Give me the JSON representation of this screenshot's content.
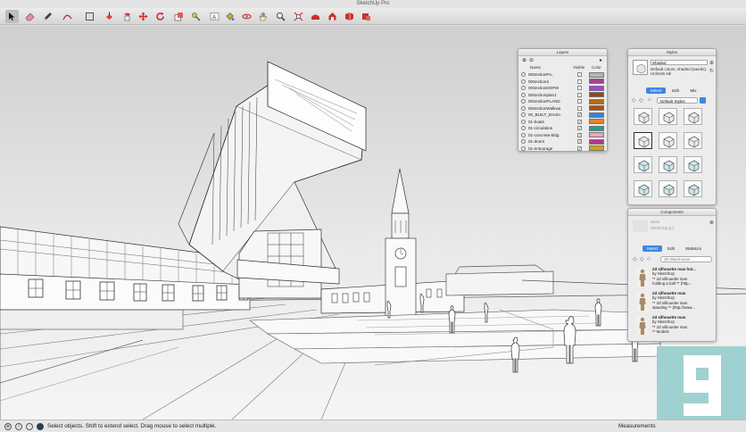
{
  "app": {
    "title": "SketchUp Pro"
  },
  "toolbar": {
    "tools": [
      {
        "icon": "select-arrow-icon",
        "active": true
      },
      {
        "icon": "eraser-icon"
      },
      {
        "icon": "line-pencil-icon"
      },
      {
        "icon": "arc-icon"
      },
      {
        "icon": "rectangle-icon"
      },
      {
        "icon": "push-pull-icon"
      },
      {
        "icon": "move-icon"
      },
      {
        "icon": "rotate-icon"
      },
      {
        "icon": "scale-icon"
      },
      {
        "icon": "offset-icon"
      },
      {
        "icon": "tape-measure-icon"
      },
      {
        "icon": "text-icon"
      },
      {
        "icon": "paint-bucket-icon"
      },
      {
        "icon": "orbit-icon"
      },
      {
        "icon": "pan-icon"
      },
      {
        "icon": "zoom-icon"
      },
      {
        "icon": "zoom-extents-icon"
      },
      {
        "icon": "warehouse-icon"
      },
      {
        "icon": "extension-warehouse-icon"
      },
      {
        "icon": "layout-icon"
      }
    ]
  },
  "layers_panel": {
    "title": "Layers",
    "columns": {
      "name": "Name",
      "visible": "Visible",
      "color": "Color"
    },
    "rows": [
      {
        "name": "00SectionPs..",
        "visible": false,
        "color": "#b5b5b5"
      },
      {
        "name": "00Section4",
        "visible": false,
        "color": "#a4438f"
      },
      {
        "name": "00SectionDOFM",
        "visible": false,
        "color": "#a83ee0"
      },
      {
        "name": "00Sectionplan1",
        "visible": false,
        "color": "#8b4a1e"
      },
      {
        "name": "00SectionPLAND",
        "visible": false,
        "color": "#b76a18"
      },
      {
        "name": "00SectionWalkwa",
        "visible": false,
        "color": "#b04c0f"
      },
      {
        "name": "00_BUILT_Enviro",
        "visible": true,
        "color": "#3f7fd6"
      },
      {
        "name": "01-boats",
        "visible": true,
        "color": "#e0842f"
      },
      {
        "name": "01-circulation",
        "visible": true,
        "color": "#2c9a8a"
      },
      {
        "name": "01-concrete-bldg",
        "visible": true,
        "color": "#f2a0c4"
      },
      {
        "name": "01-doors",
        "visible": true,
        "color": "#b03a8c"
      },
      {
        "name": "01-entourage",
        "visible": true,
        "color": "#d7a20e"
      }
    ]
  },
  "styles_panel": {
    "title": "Styles",
    "style_name": "Shaded",
    "style_desc": "Default colors, shaded (weeds). Unlimits edi",
    "tabs": [
      "Select",
      "Edit",
      "Mix"
    ],
    "collection": "Default Styles"
  },
  "components_panel": {
    "title": "Components",
    "comp_name": "Base",
    "comp_desc": "SketchUp (L)",
    "tabs": [
      "Select",
      "Edit",
      "Statistics"
    ],
    "search_placeholder": "3D Warehouse...",
    "items": [
      {
        "line1": "2d silhouette man hol...",
        "line2": "by SketchUp",
        "line3": "** 2d silhouette man",
        "line4": "holding a ball ** (http..."
      },
      {
        "line1": "2d silhouette man",
        "line2": "by SketchUp",
        "line3": "** 2d silhouette man",
        "line4": "standing ** (http://www..."
      },
      {
        "line1": "2d silhouette man",
        "line2": "by SketchUp",
        "line3": "** 2d silhouette man",
        "line4": "** Models"
      }
    ]
  },
  "statusbar": {
    "message": "Select objects. Shift to extend select. Drag mouse to select multiple.",
    "measurements_label": "Measurements"
  },
  "badge": {
    "digit": "9"
  }
}
